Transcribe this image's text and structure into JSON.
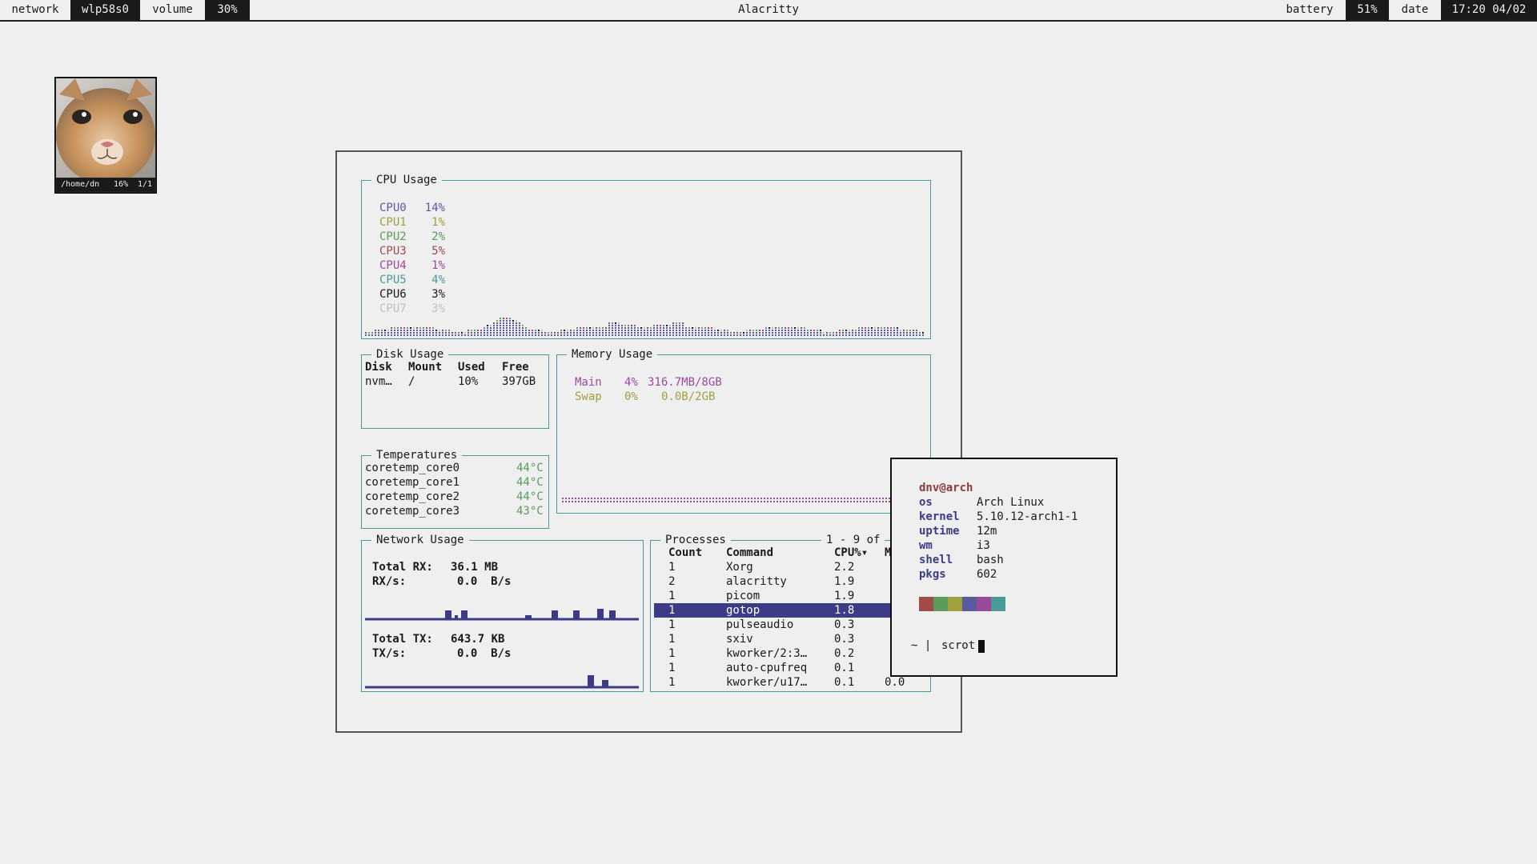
{
  "topbar": {
    "network_label": "network",
    "network_value": "wlp58s0",
    "volume_label": "volume",
    "volume_value": "30%",
    "window_title": "Alacritty",
    "battery_label": "battery",
    "battery_value": "51%",
    "date_label": "date",
    "date_value": "17:20 04/02"
  },
  "thumbnail": {
    "path": "/home/dn",
    "zoom": "16%",
    "index": "1/1"
  },
  "gotop": {
    "cpu": {
      "title": "CPU Usage",
      "cores": [
        {
          "name": "CPU0",
          "pct": "14%",
          "color": "#5a5aa0"
        },
        {
          "name": "CPU1",
          "pct": "1%",
          "color": "#a0a040"
        },
        {
          "name": "CPU2",
          "pct": "2%",
          "color": "#5a9a5a"
        },
        {
          "name": "CPU3",
          "pct": "5%",
          "color": "#a04a4a"
        },
        {
          "name": "CPU4",
          "pct": "1%",
          "color": "#9a4a9a"
        },
        {
          "name": "CPU5",
          "pct": "4%",
          "color": "#4a9a9a"
        },
        {
          "name": "CPU6",
          "pct": "3%",
          "color": "#1a1a1a"
        },
        {
          "name": "CPU7",
          "pct": "3%",
          "color": "#c0c0c0"
        }
      ]
    },
    "disk": {
      "title": "Disk Usage",
      "headers": [
        "Disk",
        "Mount",
        "Used",
        "Free"
      ],
      "row": [
        "nvm…",
        "/",
        "10%",
        "397GB"
      ]
    },
    "memory": {
      "title": "Memory Usage",
      "main": {
        "label": "Main",
        "pct": "4%",
        "value": "316.7MB/8GB",
        "color": "#9a4a9a"
      },
      "swap": {
        "label": "Swap",
        "pct": "0%",
        "value": "0.0B/2GB",
        "color": "#a0a040"
      }
    },
    "temps": {
      "title": "Temperatures",
      "rows": [
        {
          "name": "coretemp_core0",
          "value": "44°C"
        },
        {
          "name": "coretemp_core1",
          "value": "44°C"
        },
        {
          "name": "coretemp_core2",
          "value": "44°C"
        },
        {
          "name": "coretemp_core3",
          "value": "43°C"
        }
      ]
    },
    "network": {
      "title": "Network Usage",
      "total_rx_label": "Total RX:",
      "total_rx": "36.1 MB",
      "rx_rate_label": "RX/s:",
      "rx_rate": "0.0  B/s",
      "total_tx_label": "Total TX:",
      "total_tx": "643.7 KB",
      "tx_rate_label": "TX/s:",
      "tx_rate": "0.0  B/s"
    },
    "processes": {
      "title": "Processes",
      "range": "1 - 9 of",
      "headers": [
        "Count",
        "Command",
        "CPU%▾",
        "M"
      ],
      "rows": [
        [
          "1",
          "Xorg",
          "2.2",
          ""
        ],
        [
          "2",
          "alacritty",
          "1.9",
          ""
        ],
        [
          "1",
          "picom",
          "1.9",
          ""
        ],
        [
          "1",
          "gotop",
          "1.8",
          ""
        ],
        [
          "1",
          "pulseaudio",
          "0.3",
          ""
        ],
        [
          "1",
          "sxiv",
          "0.3",
          ""
        ],
        [
          "1",
          "kworker/2:3…",
          "0.2",
          ""
        ],
        [
          "1",
          "auto-cpufreq",
          "0.1",
          ""
        ],
        [
          "1",
          "kworker/u17…",
          "0.1",
          "0.0"
        ]
      ],
      "selected_index": 3
    }
  },
  "neofetch": {
    "user_host": "dnv@arch",
    "fields": [
      {
        "key": "os",
        "value": "Arch Linux"
      },
      {
        "key": "kernel",
        "value": "5.10.12-arch1-1"
      },
      {
        "key": "uptime",
        "value": "12m"
      },
      {
        "key": "wm",
        "value": "i3"
      },
      {
        "key": "shell",
        "value": "bash"
      },
      {
        "key": "pkgs",
        "value": "602"
      }
    ],
    "palette": [
      "#a04a4a",
      "#5a9a5a",
      "#a0a040",
      "#5a5aa0",
      "#9a4a9a",
      "#4a9a9a"
    ],
    "prompt": "~ | ",
    "command": "scrot"
  },
  "colors": {
    "accent": "#3b3b86",
    "border": "#4a9a9a",
    "background": "#efefef"
  }
}
